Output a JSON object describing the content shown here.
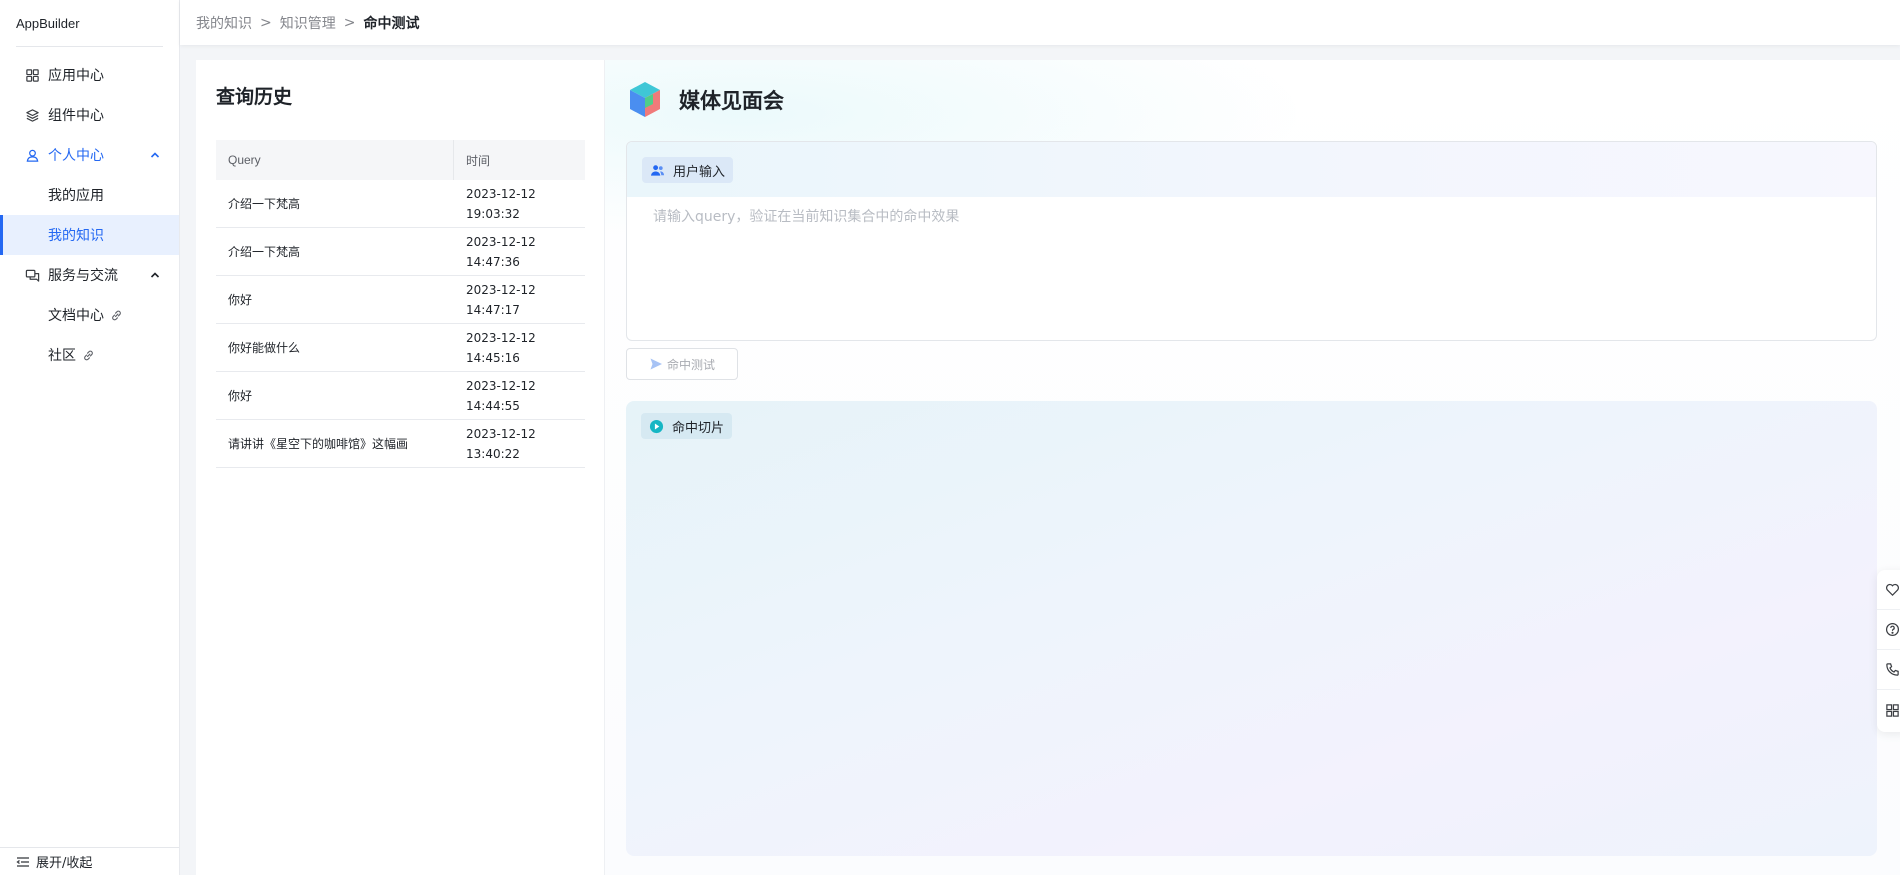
{
  "brand": "AppBuilder",
  "sidebar": {
    "items": [
      {
        "label": "应用中心",
        "icon": "grid-icon"
      },
      {
        "label": "组件中心",
        "icon": "layers-icon"
      },
      {
        "label": "个人中心",
        "icon": "user-icon"
      },
      {
        "label": "我的应用"
      },
      {
        "label": "我的知识"
      },
      {
        "label": "服务与交流",
        "icon": "chat-icon"
      },
      {
        "label": "文档中心",
        "icon": "link-icon"
      },
      {
        "label": "社区",
        "icon": "link-icon"
      }
    ],
    "bottom_label": "展开/收起",
    "active_color": "#2468f2"
  },
  "header": {
    "crumbs": [
      "我的知识",
      "知识管理"
    ],
    "separator": ">",
    "current": "命中测试"
  },
  "history": {
    "title": "查询历史",
    "columns": [
      "Query",
      "时间"
    ],
    "rows": [
      {
        "query": "介绍一下梵高",
        "date": "2023-12-12",
        "time": "19:03:32"
      },
      {
        "query": "介绍一下梵高",
        "date": "2023-12-12",
        "time": "14:47:36"
      },
      {
        "query": "你好",
        "date": "2023-12-12",
        "time": "14:47:17"
      },
      {
        "query": "你好能做什么",
        "date": "2023-12-12",
        "time": "14:45:16"
      },
      {
        "query": "你好",
        "date": "2023-12-12",
        "time": "14:44:55"
      },
      {
        "query": "请讲讲《星空下的咖啡馆》这幅画",
        "date": "2023-12-12",
        "time": "13:40:22"
      }
    ]
  },
  "main": {
    "app_name": "媒体见面会",
    "input_tag": "用户输入",
    "input_placeholder": "请输入query，验证在当前知识集合中的命中效果",
    "input_value": "",
    "test_button": "命中测试",
    "hits_tag": "命中切片"
  },
  "float_bar": [
    "heart-icon",
    "help-icon",
    "phone-icon",
    "apps-icon"
  ]
}
